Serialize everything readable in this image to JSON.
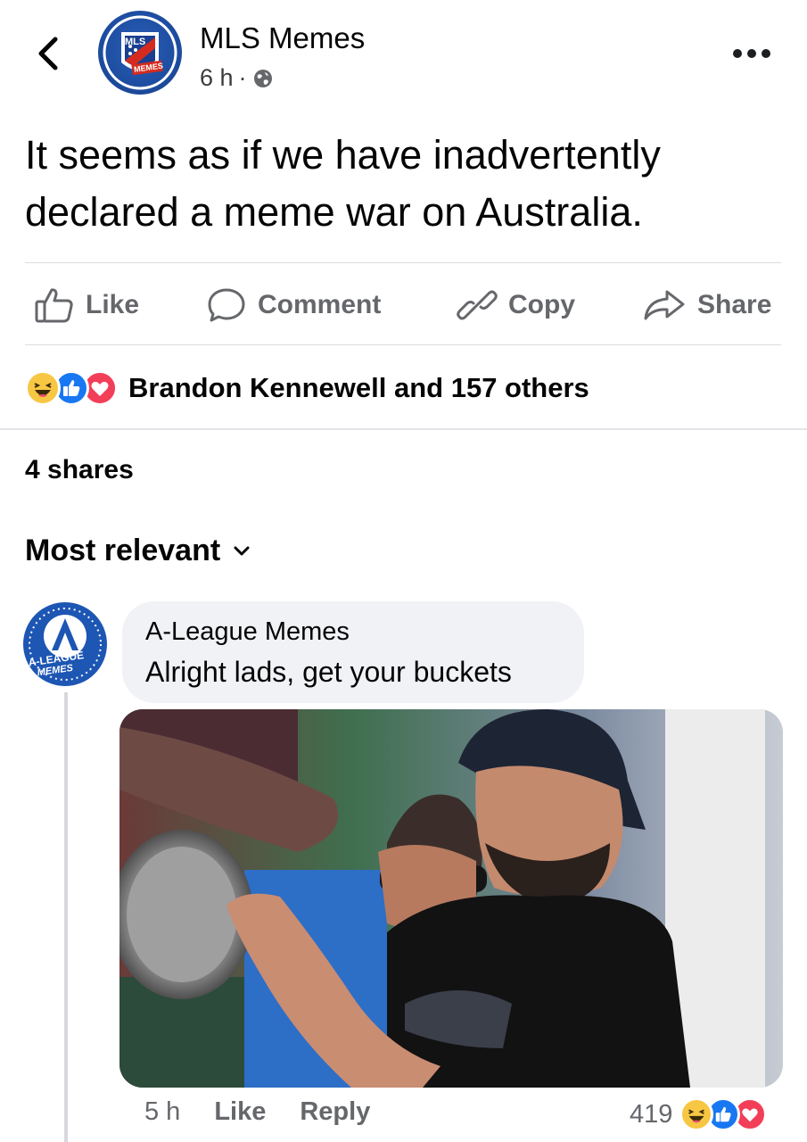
{
  "header": {
    "page_name": "MLS Memes",
    "time": "6 h",
    "separator": "·",
    "avatar_text_top": "MLS",
    "avatar_text_bottom": "MEMES"
  },
  "post": {
    "text": "It seems as if we have inadvertently declared a meme war on Australia."
  },
  "actions": {
    "like": "Like",
    "comment": "Comment",
    "copy": "Copy",
    "share": "Share"
  },
  "reactions": {
    "summary": "Brandon Kennewell and 157 others",
    "types": [
      "haha",
      "like",
      "love"
    ]
  },
  "shares": "4 shares",
  "sort": {
    "label": "Most relevant"
  },
  "comment": {
    "author": "A-League Memes",
    "avatar_text_top": "A-LEAGUE",
    "avatar_text_bottom": "MEMES",
    "text": "Alright lads, get your buckets",
    "time": "5 h",
    "like": "Like",
    "reply": "Reply",
    "reaction_count": "419"
  },
  "colors": {
    "facebook_blue": "#1877f2",
    "love_red": "#f33e58",
    "haha_yellow": "#f7c744",
    "muted_text": "#65676b"
  }
}
